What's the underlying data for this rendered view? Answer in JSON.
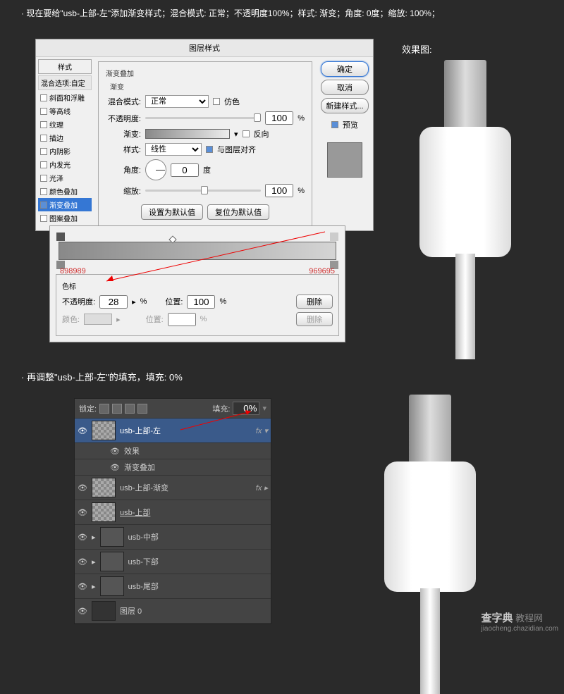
{
  "instruction1": "· 现在要给\"usb-上部-左\"添加渐变样式；混合模式: 正常；不透明度100%；样式: 渐变；角度: 0度；缩放: 100%；",
  "instruction2": "· 再调整\"usb-上部-左\"的填充，填充: 0%",
  "previewLabel": "效果图:",
  "dialog": {
    "title": "图层样式",
    "stylesHeader": "样式",
    "blendOptions": "混合选项:自定",
    "styleItems": [
      "斜面和浮雕",
      "等高线",
      "纹理",
      "描边",
      "内阴影",
      "内发光",
      "光泽",
      "颜色叠加",
      "渐变叠加",
      "图案叠加"
    ],
    "selectedIdx": 8,
    "panel": {
      "groupTitle": "渐变叠加",
      "subTitle": "渐变",
      "blendMode": {
        "label": "混合模式:",
        "value": "正常",
        "dither": "仿色"
      },
      "opacity": {
        "label": "不透明度:",
        "value": "100",
        "suffix": "%"
      },
      "gradient": {
        "label": "渐变:",
        "reverse": "反向"
      },
      "style": {
        "label": "样式:",
        "value": "线性",
        "align": "与图层对齐"
      },
      "angle": {
        "label": "角度:",
        "value": "0",
        "suffix": "度"
      },
      "scale": {
        "label": "缩放:",
        "value": "100",
        "suffix": "%"
      },
      "setDefault": "设置为默认值",
      "resetDefault": "复位为默认值"
    },
    "buttons": {
      "ok": "确定",
      "cancel": "取消",
      "newStyle": "新建样式...",
      "preview": "预览"
    }
  },
  "gradEditor": {
    "hexLeft": "898989",
    "hexRight": "969695",
    "stopsTitle": "色标",
    "opacity": {
      "label": "不透明度:",
      "value": "28",
      "suffix": "%"
    },
    "position": {
      "label": "位置:",
      "value": "100",
      "suffix": "%"
    },
    "color": {
      "label": "颜色:"
    },
    "position2": {
      "label": "位置:",
      "suffix": "%"
    },
    "delete": "删除"
  },
  "layers": {
    "lock": "锁定:",
    "fill": "填充:",
    "fillValue": "0%",
    "items": [
      {
        "name": "usb-上部-左",
        "fx": true,
        "sel": true
      },
      {
        "name": "usb-上部-渐变",
        "fx": true
      },
      {
        "name": "usb-上部",
        "underline": true
      },
      {
        "name": "usb-中部",
        "group": true
      },
      {
        "name": "usb-下部",
        "group": true
      },
      {
        "name": "usb-尾部",
        "group": true
      },
      {
        "name": "图层 0",
        "fill": true
      }
    ],
    "fxLabel": "效果",
    "gradOverlay": "渐变叠加"
  },
  "watermark": {
    "brand": "查字典",
    "text": " 教程网",
    "url": "jiaocheng.chazidian.com"
  },
  "chart_data": {
    "type": "gradient",
    "stops": [
      {
        "color": "898989",
        "position": 0,
        "opacity": 100
      },
      {
        "color": "969695",
        "position": 100,
        "opacity": 28
      }
    ]
  }
}
